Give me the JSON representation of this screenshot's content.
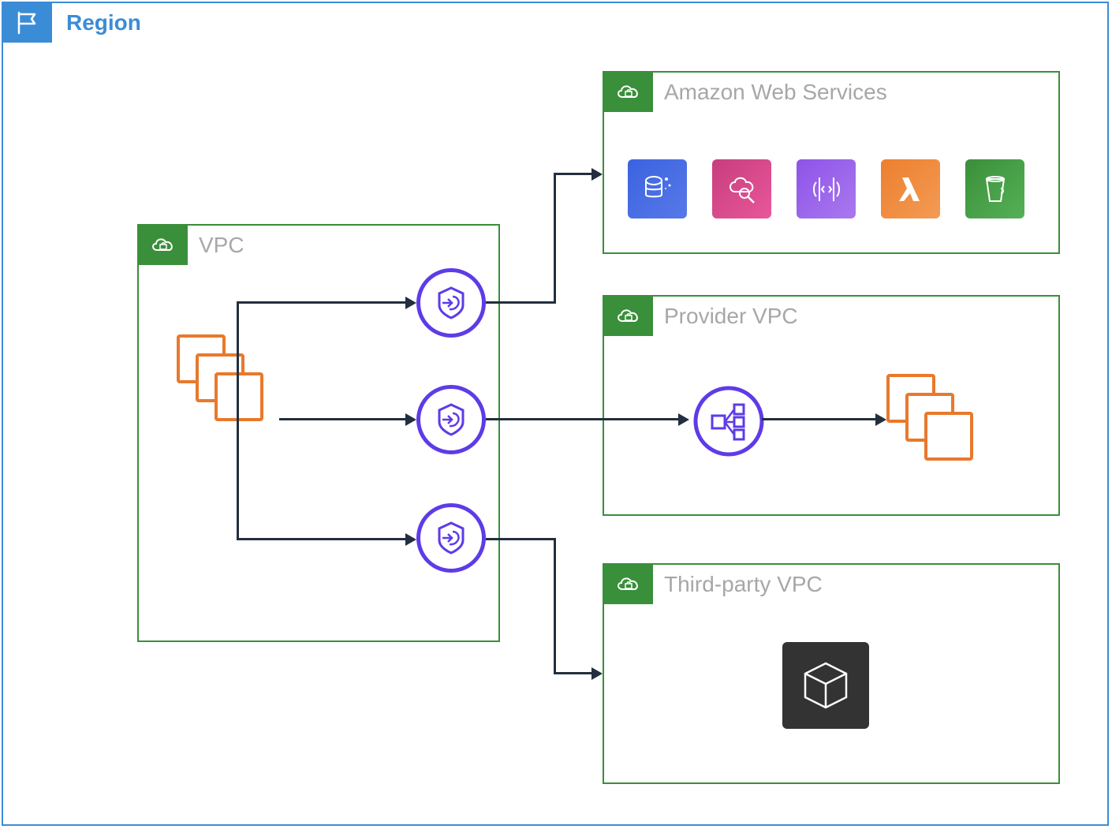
{
  "region": {
    "label": "Region"
  },
  "vpc_consumer": {
    "label": "VPC"
  },
  "aws_box": {
    "label": "Amazon Web Services",
    "services": [
      {
        "name": "rds-icon",
        "color": "#3b63e0"
      },
      {
        "name": "cloudsearch-icon",
        "color": "#c73e7d"
      },
      {
        "name": "codecommit-icon",
        "color": "#8e53e8"
      },
      {
        "name": "lambda-icon",
        "color": "#ec7f2f"
      },
      {
        "name": "s3-icon",
        "color": "#3a8f3a"
      }
    ]
  },
  "provider_vpc": {
    "label": "Provider VPC"
  },
  "third_party_vpc": {
    "label": "Third-party VPC"
  },
  "icons": {
    "endpoint": "privatelink-endpoint",
    "nlb": "network-load-balancer",
    "subnets": "subnet-collection",
    "cube": "third-party-service"
  }
}
